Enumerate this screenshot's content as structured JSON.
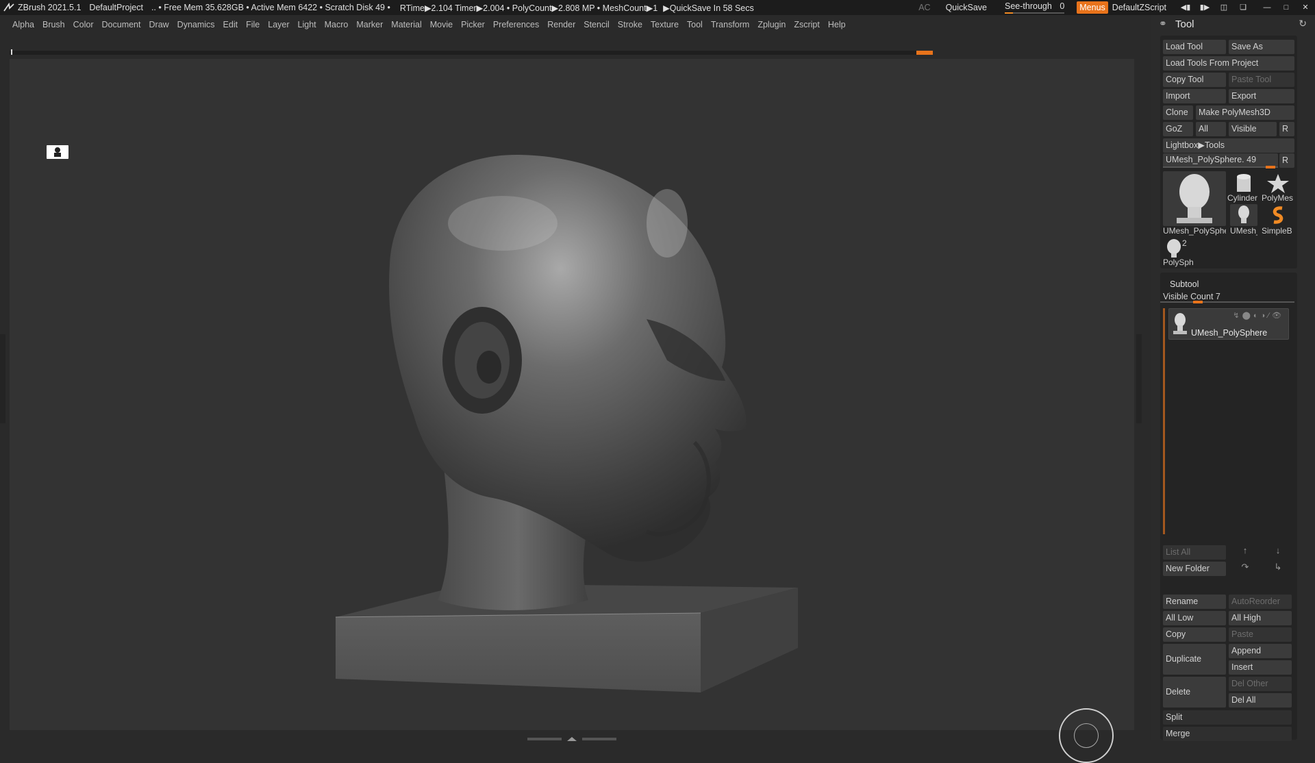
{
  "titlebar": {
    "app": "ZBrush 2021.5.1",
    "project": "DefaultProject",
    "status": ".. • Free Mem 35.628GB • Active Mem 6422 • Scratch Disk 49 •",
    "rtime": "RTime▶2.104 Timer▶2.004 • PolyCount▶2.808 MP • MeshCount▶1",
    "quicksave_status": "▶QuickSave In 58 Secs",
    "ac": "AC",
    "quicksave": "QuickSave",
    "see_through": "See-through",
    "see_through_value": "0",
    "menus": "Menus",
    "default_zscript": "DefaultZScript"
  },
  "menubar": {
    "items": [
      "Alpha",
      "Brush",
      "Color",
      "Document",
      "Draw",
      "Dynamics",
      "Edit",
      "File",
      "Layer",
      "Light",
      "Macro",
      "Marker",
      "Material",
      "Movie",
      "Picker",
      "Preferences",
      "Render",
      "Stencil",
      "Stroke",
      "Texture",
      "Tool",
      "Transform",
      "Zplugin",
      "Zscript",
      "Help"
    ]
  },
  "tool_panel": {
    "title": "Tool",
    "load_tool": "Load Tool",
    "save_as": "Save As",
    "load_tools_from_project": "Load Tools From Project",
    "copy_tool": "Copy Tool",
    "paste_tool": "Paste Tool",
    "import": "Import",
    "export": "Export",
    "clone": "Clone",
    "make_polymesh3d": "Make PolyMesh3D",
    "goz": "GoZ",
    "all": "All",
    "visible": "Visible",
    "r": "R",
    "lightbox_tools": "Lightbox▶Tools",
    "current_tool": "UMesh_PolySphere. 49",
    "thumbs": {
      "main": "UMesh_PolySphe",
      "cylinder": "Cylinder",
      "polymesh": "PolyMes",
      "umesh_small": "UMesh_",
      "simpleb": "SimpleB",
      "polysph": "PolySph",
      "polysph_count": "2"
    },
    "subtool": {
      "title": "Subtool",
      "visible_count": "Visible Count 7",
      "item_name": "UMesh_PolySphere"
    },
    "list_all": "List All",
    "new_folder": "New Folder",
    "rename": "Rename",
    "autoreorder": "AutoReorder",
    "all_low": "All Low",
    "all_high": "All High",
    "copy": "Copy",
    "paste": "Paste",
    "duplicate": "Duplicate",
    "append": "Append",
    "insert": "Insert",
    "delete": "Delete",
    "del_other": "Del Other",
    "del_all": "Del All",
    "split": "Split",
    "merge": "Merge"
  },
  "colors": {
    "accent": "#e8731b",
    "background": "#2a2a2a",
    "viewport": "#333333"
  }
}
